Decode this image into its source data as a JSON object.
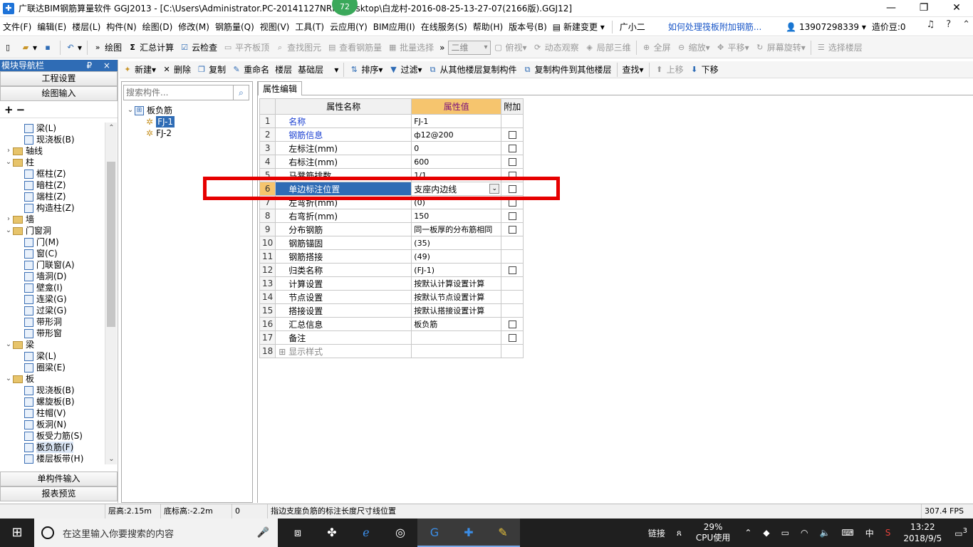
{
  "titlebar": {
    "title": "广联达BIM钢筋算量软件 GGJ2013 - [C:\\Users\\Administrator.PC-20141127NRHI\\Desktop\\白龙村-2016-08-25-13-27-07(2166版).GGJ12]",
    "badge": "72",
    "minimize": "—",
    "maximize": "❐",
    "close": "✕"
  },
  "menubar": {
    "items": [
      "文件(F)",
      "编辑(E)",
      "楼层(L)",
      "构件(N)",
      "绘图(D)",
      "修改(M)",
      "钢筋量(Q)",
      "视图(V)",
      "工具(T)",
      "云应用(Y)",
      "BIM应用(I)",
      "在线服务(S)",
      "帮助(H)",
      "版本号(B)"
    ],
    "new_change": "新建变更",
    "assistant": "广小二",
    "question_link": "如何处理筏板附加钢筋...",
    "phone": "13907298339",
    "beans": "造价豆:0"
  },
  "toolbar1": {
    "draw": "绘图",
    "sum_calc": "汇总计算",
    "cloud_check": "云检查",
    "align_slab": "平齐板顶",
    "find_element": "查找图元",
    "view_rebar": "查看钢筋量",
    "batch_select": "批量选择",
    "view_mode": "二维",
    "top_view": "俯视",
    "dynamic_view": "动态观察",
    "local_3d": "局部三维",
    "fullscreen": "全屏",
    "zoom": "缩放",
    "pan": "平移",
    "rotate": "屏幕旋转",
    "select_floor": "选择楼层"
  },
  "leftpanel": {
    "header": "模块导航栏",
    "header_btns": "₽ ×",
    "project_settings": "工程设置",
    "drawing_input": "绘图输入",
    "single_input": "单构件输入",
    "report_preview": "报表预览",
    "tree": [
      {
        "level": 2,
        "label": "梁(L)",
        "icon": "beam-icon"
      },
      {
        "level": 2,
        "label": "现浇板(B)",
        "icon": "slab-icon"
      },
      {
        "level": 0,
        "label": "轴线",
        "folder": true,
        "tog": "›"
      },
      {
        "level": 0,
        "label": "柱",
        "folder": true,
        "tog": "⌄"
      },
      {
        "level": 2,
        "label": "框柱(Z)",
        "icon": "column-icon"
      },
      {
        "level": 2,
        "label": "暗柱(Z)",
        "icon": "column-icon"
      },
      {
        "level": 2,
        "label": "端柱(Z)",
        "icon": "column-icon"
      },
      {
        "level": 2,
        "label": "构造柱(Z)",
        "icon": "column-icon"
      },
      {
        "level": 0,
        "label": "墙",
        "folder": true,
        "tog": "›"
      },
      {
        "level": 0,
        "label": "门窗洞",
        "folder": true,
        "tog": "⌄"
      },
      {
        "level": 2,
        "label": "门(M)",
        "icon": "door-icon"
      },
      {
        "level": 2,
        "label": "窗(C)",
        "icon": "window-icon"
      },
      {
        "level": 2,
        "label": "门联窗(A)",
        "icon": "door-window-icon"
      },
      {
        "level": 2,
        "label": "墙洞(D)",
        "icon": "wall-hole-icon"
      },
      {
        "level": 2,
        "label": "壁龛(I)",
        "icon": "niche-icon"
      },
      {
        "level": 2,
        "label": "连梁(G)",
        "icon": "link-beam-icon"
      },
      {
        "level": 2,
        "label": "过梁(G)",
        "icon": "lintel-icon"
      },
      {
        "level": 2,
        "label": "带形洞",
        "icon": "strip-hole-icon"
      },
      {
        "level": 2,
        "label": "带形窗",
        "icon": "strip-window-icon"
      },
      {
        "level": 0,
        "label": "梁",
        "folder": true,
        "tog": "⌄"
      },
      {
        "level": 2,
        "label": "梁(L)",
        "icon": "beam-icon"
      },
      {
        "level": 2,
        "label": "圈梁(E)",
        "icon": "ring-beam-icon"
      },
      {
        "level": 0,
        "label": "板",
        "folder": true,
        "tog": "⌄"
      },
      {
        "level": 2,
        "label": "现浇板(B)",
        "icon": "slab-icon"
      },
      {
        "level": 2,
        "label": "螺旋板(B)",
        "icon": "spiral-slab-icon"
      },
      {
        "level": 2,
        "label": "柱帽(V)",
        "icon": "column-cap-icon"
      },
      {
        "level": 2,
        "label": "板洞(N)",
        "icon": "slab-hole-icon"
      },
      {
        "level": 2,
        "label": "板受力筋(S)",
        "icon": "slab-rebar-icon"
      },
      {
        "level": 2,
        "label": "板负筋(F)",
        "icon": "negative-rebar-icon",
        "selected": true
      },
      {
        "level": 2,
        "label": "楼层板带(H)",
        "icon": "slab-band-icon"
      }
    ]
  },
  "toolbar2": {
    "new": "新建",
    "delete": "删除",
    "copy": "复制",
    "rename": "重命名",
    "floor_label": "楼层",
    "floor_value": "基础层",
    "sort": "排序",
    "filter": "过滤",
    "copy_from_floor": "从其他楼层复制构件",
    "copy_to_floor": "复制构件到其他楼层",
    "find": "查找",
    "move_up": "上移",
    "move_down": "下移"
  },
  "complist": {
    "search_placeholder": "搜索构件...",
    "root": "板负筋",
    "items": [
      "FJ-1",
      "FJ-2"
    ]
  },
  "propeditor": {
    "tab": "属性编辑",
    "col_name": "属性名称",
    "col_value": "属性值",
    "col_add": "附加",
    "rows": [
      {
        "no": "1",
        "name": "名称",
        "value": "FJ-1",
        "blue": true,
        "chk": false
      },
      {
        "no": "2",
        "name": "钢筋信息",
        "value": "ф12@200",
        "blue": true,
        "chk": true
      },
      {
        "no": "3",
        "name": "左标注(mm)",
        "value": "0",
        "chk": true
      },
      {
        "no": "4",
        "name": "右标注(mm)",
        "value": "600",
        "chk": true
      },
      {
        "no": "5",
        "name": "马凳筋排数",
        "value": "1/1",
        "chk": true
      },
      {
        "no": "6",
        "name": "单边标注位置",
        "value": "支座内边线",
        "chk": true,
        "current": true
      },
      {
        "no": "7",
        "name": "左弯折(mm)",
        "value": "(0)",
        "chk": true
      },
      {
        "no": "8",
        "name": "右弯折(mm)",
        "value": "150",
        "chk": true
      },
      {
        "no": "9",
        "name": "分布钢筋",
        "value": "同一板厚的分布筋相同",
        "chk": true
      },
      {
        "no": "10",
        "name": "钢筋锚固",
        "value": "(35)",
        "chk": false
      },
      {
        "no": "11",
        "name": "钢筋搭接",
        "value": "(49)",
        "chk": false
      },
      {
        "no": "12",
        "name": "归类名称",
        "value": "(FJ-1)",
        "chk": true
      },
      {
        "no": "13",
        "name": "计算设置",
        "value": "按默认计算设置计算",
        "chk": false
      },
      {
        "no": "14",
        "name": "节点设置",
        "value": "按默认节点设置计算",
        "chk": false
      },
      {
        "no": "15",
        "name": "搭接设置",
        "value": "按默认搭接设置计算",
        "chk": false
      },
      {
        "no": "16",
        "name": "汇总信息",
        "value": "板负筋",
        "chk": true
      },
      {
        "no": "17",
        "name": "备注",
        "value": "",
        "chk": true
      },
      {
        "no": "18",
        "name": "显示样式",
        "value": "",
        "chk": false,
        "expander": true
      }
    ]
  },
  "statusbar": {
    "floor_height": "层高:2.15m",
    "base_height": "底标高:-2.2m",
    "zero": "0",
    "hint": "指边支座负筋的标注长度尺寸线位置",
    "fps": "307.4 FPS"
  },
  "taskbar": {
    "search_placeholder": "在这里输入你要搜索的内容",
    "link": "链接",
    "cpu_percent": "29%",
    "cpu_label": "CPU使用",
    "ime": "中",
    "time": "13:22",
    "date": "2018/9/5",
    "notifications": "3"
  }
}
